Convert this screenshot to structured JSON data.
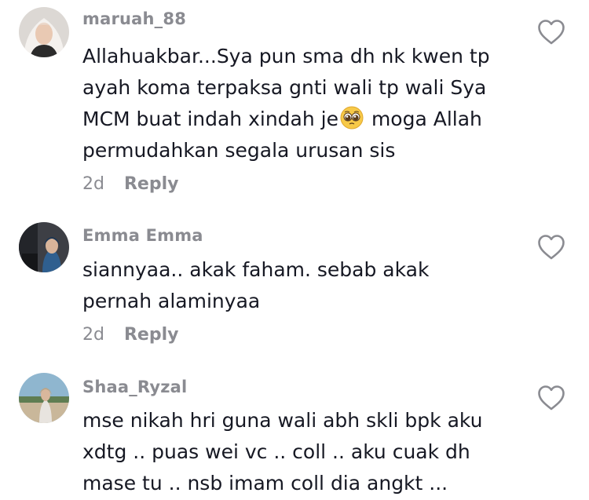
{
  "comments": [
    {
      "username": "maruah_88",
      "text_before_emoji": "Allahuakbar...Sya pun sma dh nk kwen tp ayah koma terpaksa gnti wali tp wali Sya MCM buat indah xindah je",
      "emoji": "pleading-face",
      "text_after_emoji": " moga Allah permudahkan segala urusan sis",
      "time": "2d",
      "reply_label": "Reply"
    },
    {
      "username": "Emma Emma",
      "text": "siannyaa.. akak faham. sebab akak pernah alaminyaa",
      "time": "2d",
      "reply_label": "Reply"
    },
    {
      "username": "Shaa_Ryzal",
      "text": "mse nikah hri guna wali abh skli bpk aku xdtg .. puas wei vc .. coll .. aku cuak dh mase tu .. nsb imam coll dia angkt ..."
    }
  ],
  "colors": {
    "username": "#8a8b91",
    "text": "#161823",
    "meta": "#8a8b91",
    "like_outline": "#8a8b91"
  },
  "icons": [
    "heart-outline-icon",
    "pleading-face-emoji"
  ]
}
